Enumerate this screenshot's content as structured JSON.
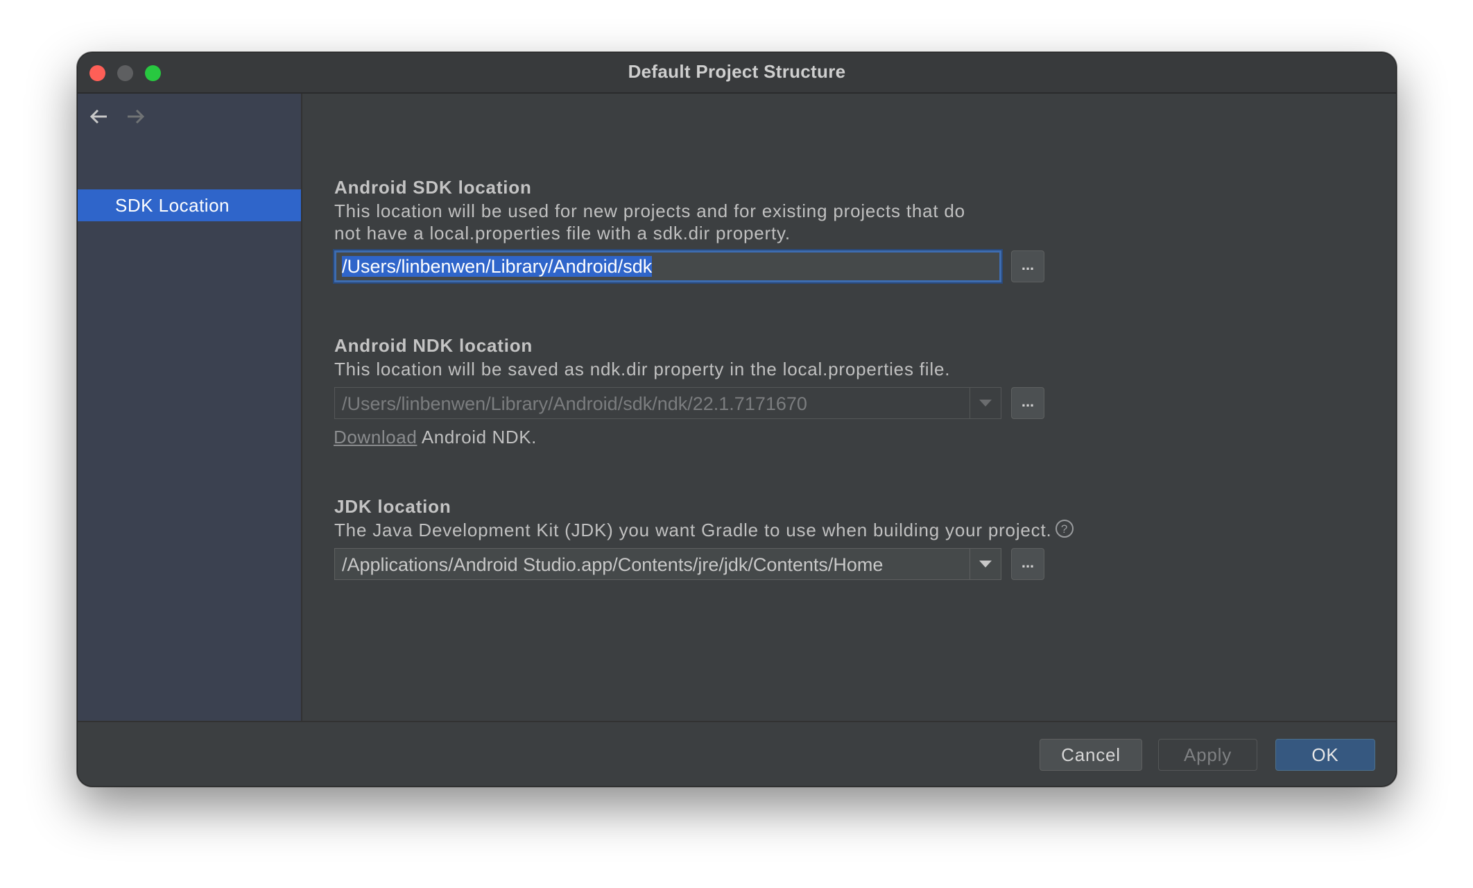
{
  "window": {
    "title": "Default Project Structure"
  },
  "sidebar": {
    "items": [
      {
        "label": "SDK Location",
        "selected": true
      }
    ]
  },
  "sdk": {
    "heading": "Android SDK location",
    "description": "This location will be used for new projects and for existing projects that do\nnot have a local.properties file with a sdk.dir property.",
    "value": "/Users/linbenwen/Library/Android/sdk",
    "browse_label": "..."
  },
  "ndk": {
    "heading": "Android NDK location",
    "description": "This location will be saved as ndk.dir property in the local.properties file.",
    "value": "/Users/linbenwen/Library/Android/sdk/ndk/22.1.7171670",
    "browse_label": "...",
    "download_link": "Download",
    "download_suffix": " Android NDK."
  },
  "jdk": {
    "heading": "JDK location",
    "description": "The Java Development Kit (JDK) you want Gradle to use when building your project.",
    "value": "/Applications/Android Studio.app/Contents/jre/jdk/Contents/Home",
    "browse_label": "..."
  },
  "footer": {
    "cancel_label": "Cancel",
    "apply_label": "Apply",
    "ok_label": "OK"
  },
  "colors": {
    "selection": "#2f65ca",
    "ok_button": "#365880",
    "close": "#fe5f57",
    "maximize": "#28c840"
  }
}
